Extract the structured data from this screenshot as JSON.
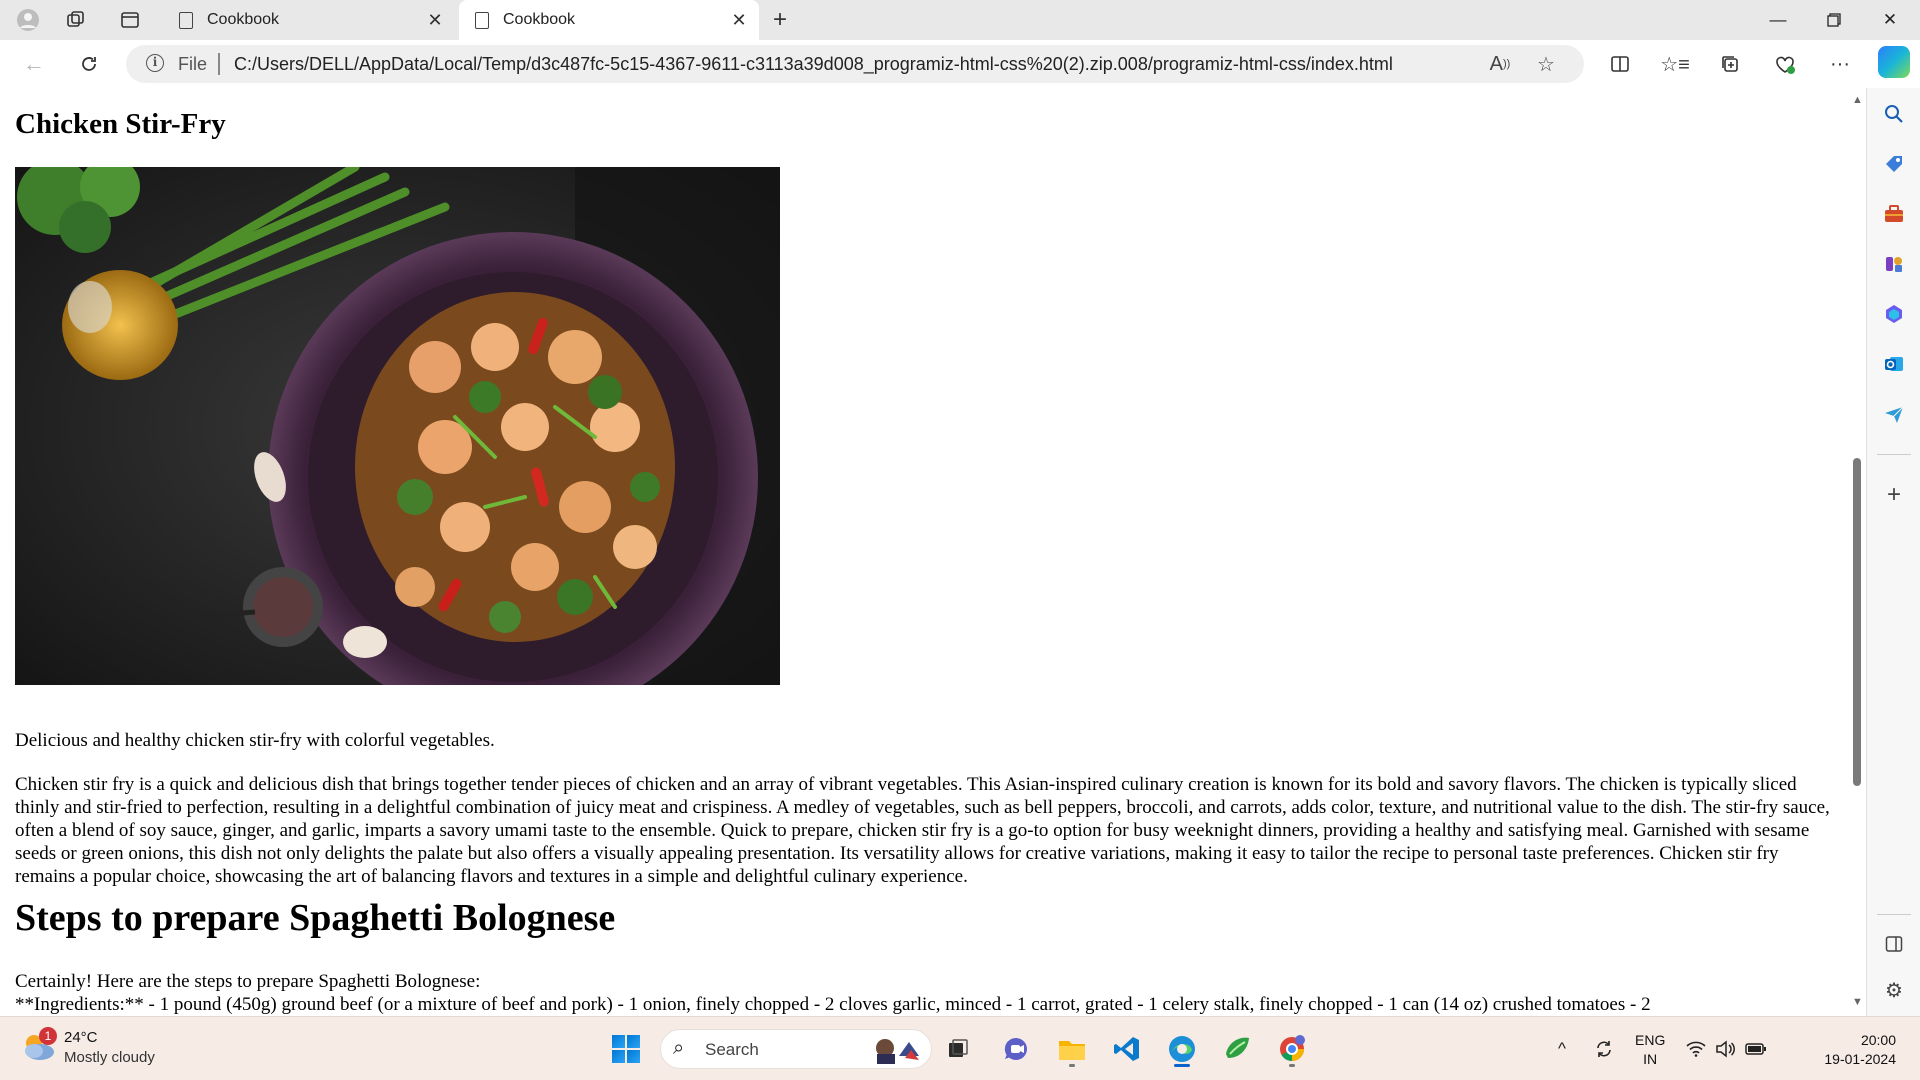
{
  "browser": {
    "tabs": [
      {
        "label": "Cookbook",
        "active": false
      },
      {
        "label": "Cookbook",
        "active": true
      }
    ],
    "address": {
      "scheme_label": "File",
      "url": "C:/Users/DELL/AppData/Local/Temp/d3c487fc-5c15-4367-9611-c3113a39d008_programiz-html-css%20(2).zip.008/programiz-html-css/index.html"
    },
    "icons": {
      "profile": "profile-icon",
      "workspaces": "workspaces-icon",
      "tab_actions": "vertical-tabs-icon",
      "back": "back-arrow-icon",
      "refresh": "refresh-icon",
      "read_aloud": "read-aloud-icon",
      "favorite": "star-icon"
    }
  },
  "page": {
    "recipe_title": "Chicken Stir-Fry",
    "image_alt": "Chicken stir-fry with vegetables in a dark bowl",
    "caption": "Delicious and healthy chicken stir-fry with colorful vegetables.",
    "description": "Chicken stir fry is a quick and delicious dish that brings together tender pieces of chicken and an array of vibrant vegetables. This Asian-inspired culinary creation is known for its bold and savory flavors. The chicken is typically sliced thinly and stir-fried to perfection, resulting in a delightful combination of juicy meat and crispiness. A medley of vegetables, such as bell peppers, broccoli, and carrots, adds color, texture, and nutritional value to the dish. The stir-fry sauce, often a blend of soy sauce, ginger, and garlic, imparts a savory umami taste to the ensemble. Quick to prepare, chicken stir fry is a go-to option for busy weeknight dinners, providing a healthy and satisfying meal. Garnished with sesame seeds or green onions, this dish not only delights the palate but also offers a visually appealing presentation. Its versatility allows for creative variations, making it easy to tailor the recipe to personal taste preferences. Chicken stir fry remains a popular choice, showcasing the art of balancing flavors and textures in a simple and delightful culinary experience.",
    "steps_heading": "Steps to prepare Spaghetti Bolognese",
    "steps_intro": "Certainly! Here are the steps to prepare Spaghetti Bolognese:",
    "ingredients_line": "**Ingredients:** - 1 pound (450g) ground beef (or a mixture of beef and pork) - 1 onion, finely chopped - 2 cloves garlic, minced - 1 carrot, grated - 1 celery stalk, finely chopped - 1 can (14 oz) crushed tomatoes - 2"
  },
  "taskbar": {
    "weather": {
      "temp": "24°C",
      "desc": "Mostly cloudy",
      "badge": "1"
    },
    "search_label": "Search",
    "lang_line1": "ENG",
    "lang_line2": "IN",
    "time": "20:00",
    "date": "19-01-2024"
  },
  "colors": {
    "taskbar_bg": "#f6ebe5",
    "accent": "#0a63c9"
  }
}
